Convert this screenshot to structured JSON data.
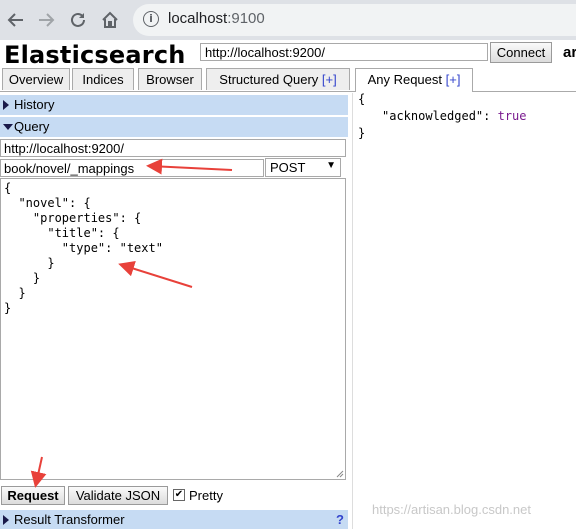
{
  "browser": {
    "url_host": "localhost",
    "url_port": ":9100"
  },
  "header": {
    "title": "Elasticsearch",
    "cluster_url": "http://localhost:9200/",
    "connect_label": "Connect",
    "cluster_name_fragment": "ar"
  },
  "tabs": [
    {
      "label": "Overview",
      "plus": ""
    },
    {
      "label": "Indices",
      "plus": ""
    },
    {
      "label": "Browser",
      "plus": ""
    },
    {
      "label": "Structured Query ",
      "plus": "[+]"
    },
    {
      "label": "Any Request ",
      "plus": "[+]"
    }
  ],
  "left": {
    "history_label": "History",
    "query_label": "Query",
    "base_url": "http://localhost:9200/",
    "path": "book/novel/_mappings",
    "method": "POST",
    "body": "{\n  \"novel\": {\n    \"properties\": {\n      \"title\": {\n        \"type\": \"text\"\n      }\n    }\n  }\n}",
    "request_label": "Request",
    "validate_label": "Validate JSON",
    "pretty_label": "Pretty",
    "pretty_checked": true,
    "result_transformer_label": "Result Transformer",
    "help_label": "?"
  },
  "result": {
    "open": "{",
    "key": "\"acknowledged\": ",
    "value": "true",
    "close": "}"
  },
  "watermark": "https://artisan.blog.csdn.net",
  "colors": {
    "section_bar": "#c6dbf3",
    "annotation_arrow": "#e8413a",
    "json_bool": "#7a1b8f"
  }
}
